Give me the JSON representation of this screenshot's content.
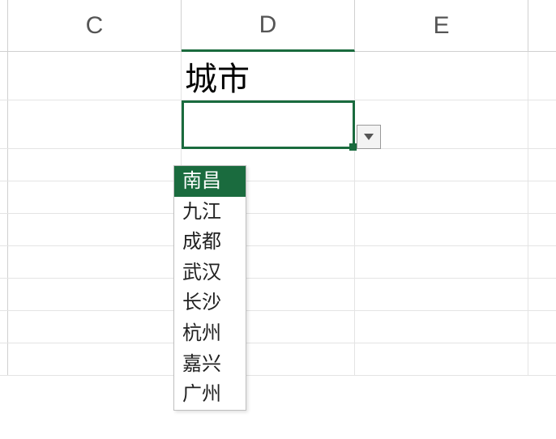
{
  "columns": {
    "c": "C",
    "d": "D",
    "e": "E"
  },
  "header_cell": {
    "label": "城市"
  },
  "selected_cell": {
    "value": ""
  },
  "dropdown": {
    "options": [
      "南昌",
      "九江",
      "成都",
      "武汉",
      "长沙",
      "杭州",
      "嘉兴",
      "广州"
    ],
    "selected_index": 0
  }
}
